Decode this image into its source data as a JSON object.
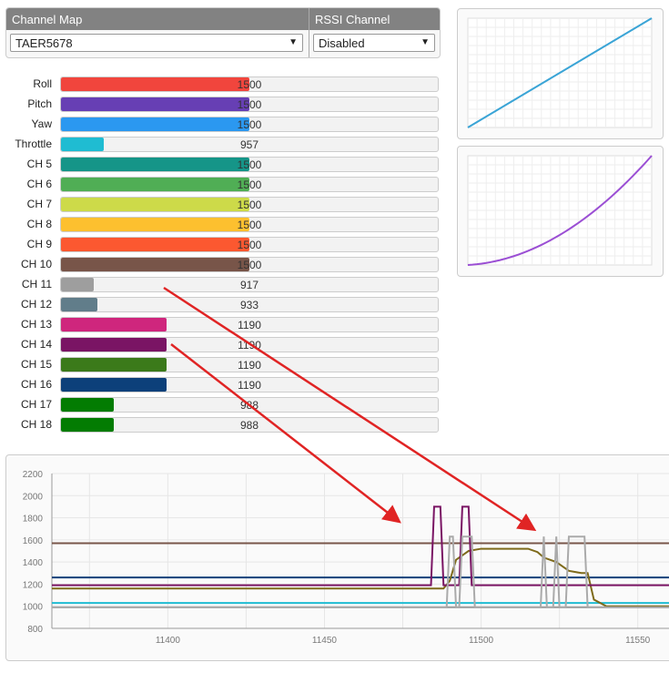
{
  "channel_map": {
    "header": "Channel Map",
    "value": "TAER5678"
  },
  "rssi_channel": {
    "header": "RSSI Channel",
    "value": "Disabled"
  },
  "channels": [
    {
      "label": "Roll",
      "value": "1500",
      "fraction": 0.5,
      "color": "#f1453d"
    },
    {
      "label": "Pitch",
      "value": "1500",
      "fraction": 0.5,
      "color": "#673fb4"
    },
    {
      "label": "Yaw",
      "value": "1500",
      "fraction": 0.5,
      "color": "#2b98f0"
    },
    {
      "label": "Throttle",
      "value": "957",
      "fraction": 0.114,
      "color": "#1fbcd2"
    },
    {
      "label": "CH 5",
      "value": "1500",
      "fraction": 0.5,
      "color": "#159588"
    },
    {
      "label": "CH 6",
      "value": "1500",
      "fraction": 0.5,
      "color": "#50ae55"
    },
    {
      "label": "CH 7",
      "value": "1500",
      "fraction": 0.5,
      "color": "#cdda49"
    },
    {
      "label": "CH 8",
      "value": "1500",
      "fraction": 0.5,
      "color": "#fdc02f"
    },
    {
      "label": "CH 9",
      "value": "1500",
      "fraction": 0.5,
      "color": "#fc5830"
    },
    {
      "label": "CH 10",
      "value": "1500",
      "fraction": 0.5,
      "color": "#785549"
    },
    {
      "label": "CH 11",
      "value": "917",
      "fraction": 0.087,
      "color": "#9e9e9e"
    },
    {
      "label": "CH 12",
      "value": "933",
      "fraction": 0.097,
      "color": "#617d8a"
    },
    {
      "label": "CH 13",
      "value": "1190",
      "fraction": 0.28,
      "color": "#cf267d"
    },
    {
      "label": "CH 14",
      "value": "1190",
      "fraction": 0.28,
      "color": "#7a1464"
    },
    {
      "label": "CH 15",
      "value": "1190",
      "fraction": 0.28,
      "color": "#3b7a1a"
    },
    {
      "label": "CH 16",
      "value": "1190",
      "fraction": 0.28,
      "color": "#0c407a"
    },
    {
      "label": "CH 17",
      "value": "988",
      "fraction": 0.14,
      "color": "#037c02"
    },
    {
      "label": "CH 18",
      "value": "988",
      "fraction": 0.14,
      "color": "#037c02"
    }
  ],
  "rc_curve": {
    "color": "#3aa4d6",
    "shape": "linear"
  },
  "expo_curve": {
    "color": "#9b4fd4",
    "shape": "quadratic"
  },
  "chart_data": {
    "type": "line",
    "ylim": [
      800,
      2200
    ],
    "yticks": [
      800,
      1000,
      1200,
      1400,
      1600,
      1800,
      2000,
      2200
    ],
    "xlim": [
      11363,
      11562
    ],
    "xticks": [
      11400,
      11450,
      11500,
      11550
    ],
    "series": [
      {
        "color": "#785549",
        "points": [
          [
            11363,
            1570
          ],
          [
            11562,
            1570
          ]
        ]
      },
      {
        "color": "#0c407a",
        "points": [
          [
            11363,
            1260
          ],
          [
            11562,
            1260
          ]
        ]
      },
      {
        "color": "#1fbcd2",
        "points": [
          [
            11363,
            1030
          ],
          [
            11562,
            1030
          ]
        ]
      },
      {
        "color": "#9e9e9e",
        "points": [
          [
            11363,
            990
          ],
          [
            11562,
            990
          ]
        ]
      },
      {
        "color": "#7e6a1a",
        "points": [
          [
            11363,
            1160
          ],
          [
            11488,
            1160
          ],
          [
            11490,
            1230
          ],
          [
            11492,
            1420
          ],
          [
            11496,
            1500
          ],
          [
            11500,
            1520
          ],
          [
            11510,
            1520
          ],
          [
            11515,
            1520
          ],
          [
            11518,
            1490
          ],
          [
            11520,
            1440
          ],
          [
            11524,
            1400
          ],
          [
            11528,
            1320
          ],
          [
            11532,
            1300
          ],
          [
            11534,
            1300
          ],
          [
            11536,
            1060
          ],
          [
            11540,
            1000
          ],
          [
            11562,
            1000
          ]
        ]
      },
      {
        "color": "#7a1464",
        "points": [
          [
            11363,
            1190
          ],
          [
            11484,
            1190
          ],
          [
            11485,
            1900
          ],
          [
            11487,
            1900
          ],
          [
            11488,
            1190
          ],
          [
            11493,
            1190
          ],
          [
            11494,
            1900
          ],
          [
            11496,
            1900
          ],
          [
            11497,
            1190
          ],
          [
            11562,
            1190
          ]
        ]
      },
      {
        "color": "#aaaaaa",
        "points": [
          [
            11363,
            990
          ],
          [
            11489,
            990
          ],
          [
            11490,
            1630
          ],
          [
            11491,
            1630
          ],
          [
            11492,
            990
          ],
          [
            11493,
            990
          ],
          [
            11494,
            1630
          ],
          [
            11497,
            1630
          ],
          [
            11498,
            990
          ],
          [
            11519,
            990
          ],
          [
            11520,
            1630
          ],
          [
            11521,
            990
          ],
          [
            11523,
            990
          ],
          [
            11524,
            1630
          ],
          [
            11525,
            990
          ],
          [
            11527,
            990
          ],
          [
            11528,
            1630
          ],
          [
            11533,
            1630
          ],
          [
            11534,
            990
          ],
          [
            11562,
            990
          ]
        ]
      }
    ]
  }
}
